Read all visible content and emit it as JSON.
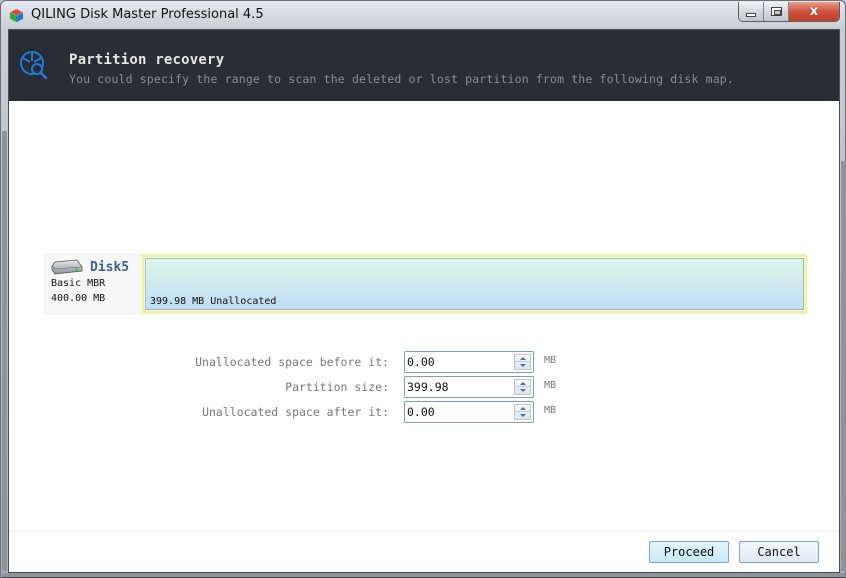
{
  "window": {
    "title": "QILING Disk Master Professional 4.5",
    "app_icon": "cube-app-icon",
    "controls": {
      "minimize_icon": "minimize-icon",
      "maximize_icon": "maximize-icon",
      "close_label": "x"
    }
  },
  "header": {
    "icon": "partition-search-icon",
    "title": "Partition recovery",
    "subtitle": "You could specify the range to scan the deleted or lost partition from the following disk map."
  },
  "disk": {
    "icon": "hard-disk-icon",
    "name": "Disk5",
    "type": "Basic MBR",
    "size": "400.00 MB",
    "partitions": [
      {
        "label": "399.98 MB Unallocated"
      }
    ]
  },
  "form": {
    "fields": [
      {
        "label": "Unallocated space before it:",
        "value": "0.00",
        "unit": "MB"
      },
      {
        "label": "Partition size:",
        "value": "399.98",
        "unit": "MB"
      },
      {
        "label": "Unallocated space after it:",
        "value": "0.00",
        "unit": "MB"
      }
    ]
  },
  "footer": {
    "proceed_label": "Proceed",
    "cancel_label": "Cancel"
  },
  "colors": {
    "header_bg": "#2a2d33",
    "accent_blue": "#1e7be0",
    "disk_name": "#3b5f9a",
    "close_red": "#c23f28"
  }
}
